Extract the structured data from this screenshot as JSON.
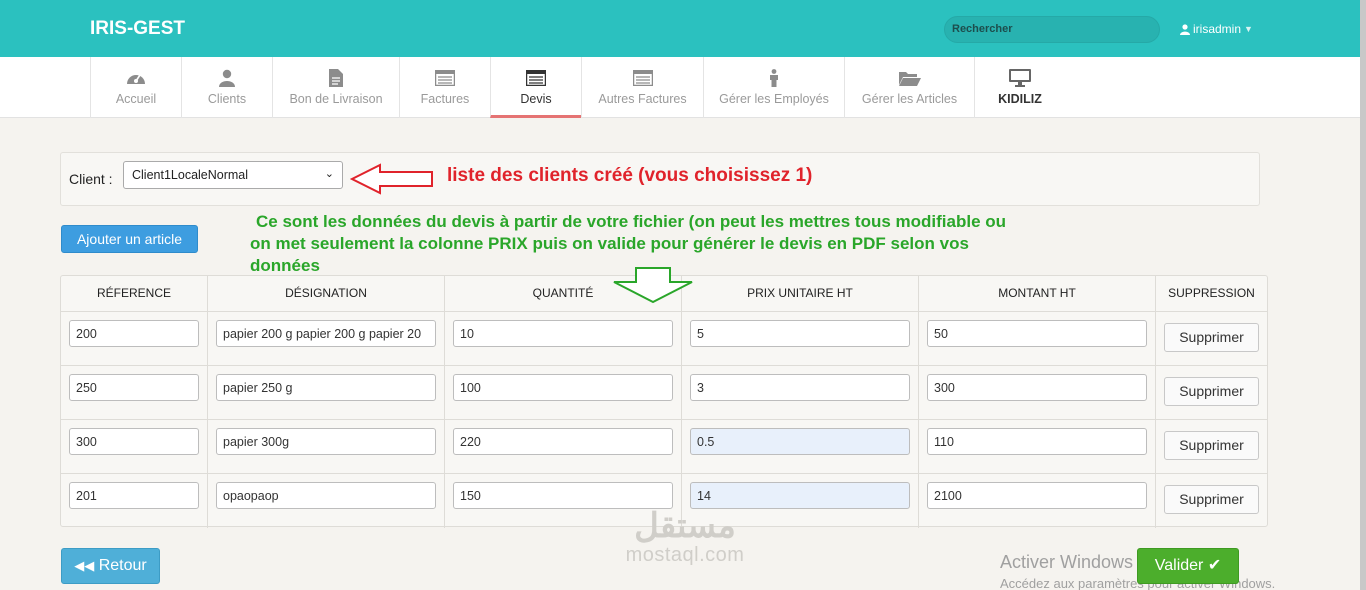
{
  "app": {
    "title": "IRIS-GEST"
  },
  "header": {
    "search_placeholder": "Rechercher",
    "user": "irisadmin"
  },
  "tabs": [
    {
      "label": "Accueil",
      "icon": "dashboard-icon"
    },
    {
      "label": "Clients",
      "icon": "user-icon"
    },
    {
      "label": "Bon de Livraison",
      "icon": "file-icon"
    },
    {
      "label": "Factures",
      "icon": "list-icon"
    },
    {
      "label": "Devis",
      "icon": "list-icon",
      "active": true
    },
    {
      "label": "Autres Factures",
      "icon": "list-icon"
    },
    {
      "label": "Gérer les Employés",
      "icon": "person-icon"
    },
    {
      "label": "Gérer les Articles",
      "icon": "folder-icon"
    },
    {
      "label": "KIDILIZ",
      "icon": "monitor-icon"
    }
  ],
  "client": {
    "label": "Client :",
    "selected": "Client1LocaleNormal"
  },
  "annotations": {
    "red": "liste des clients créé (vous choisissez 1)",
    "green_line1": "Ce sont les données du devis à partir de votre fichier (on peut les mettres tous modifiable ou",
    "green_line2": "on met seulement la colonne PRIX puis on valide pour générer le devis en PDF selon vos",
    "green_line3": "données"
  },
  "buttons": {
    "add_article": "Ajouter un article",
    "back": "Retour",
    "validate": "Valider",
    "delete": "Supprimer"
  },
  "table": {
    "headers": [
      "Réference",
      "Désignation",
      "Quantité",
      "Prix unitaire HT",
      "Montant HT",
      "Suppression"
    ],
    "rows": [
      {
        "ref": "200",
        "designation": "papier 200 g papier 200 g papier 20",
        "qty": "10",
        "price": "5",
        "amount": "50"
      },
      {
        "ref": "250",
        "designation": "papier 250 g",
        "qty": "100",
        "price": "3",
        "amount": "300"
      },
      {
        "ref": "300",
        "designation": "papier 300g",
        "qty": "220",
        "price": "0.5",
        "amount": "110"
      },
      {
        "ref": "201",
        "designation": "opaopaop",
        "qty": "150",
        "price": "14",
        "amount": "2100"
      }
    ]
  },
  "watermark": {
    "windows_title": "Activer Windows",
    "windows_sub": "Accédez aux paramètres pour activer Windows.",
    "brand_ar": "مستقل",
    "brand_latin": "mostaql.com"
  },
  "colors": {
    "navbar": "#2bc1bf",
    "annotation_red": "#e0232b",
    "annotation_green": "#2aa62a",
    "primary": "#3d9de0",
    "success": "#4cae2c"
  }
}
